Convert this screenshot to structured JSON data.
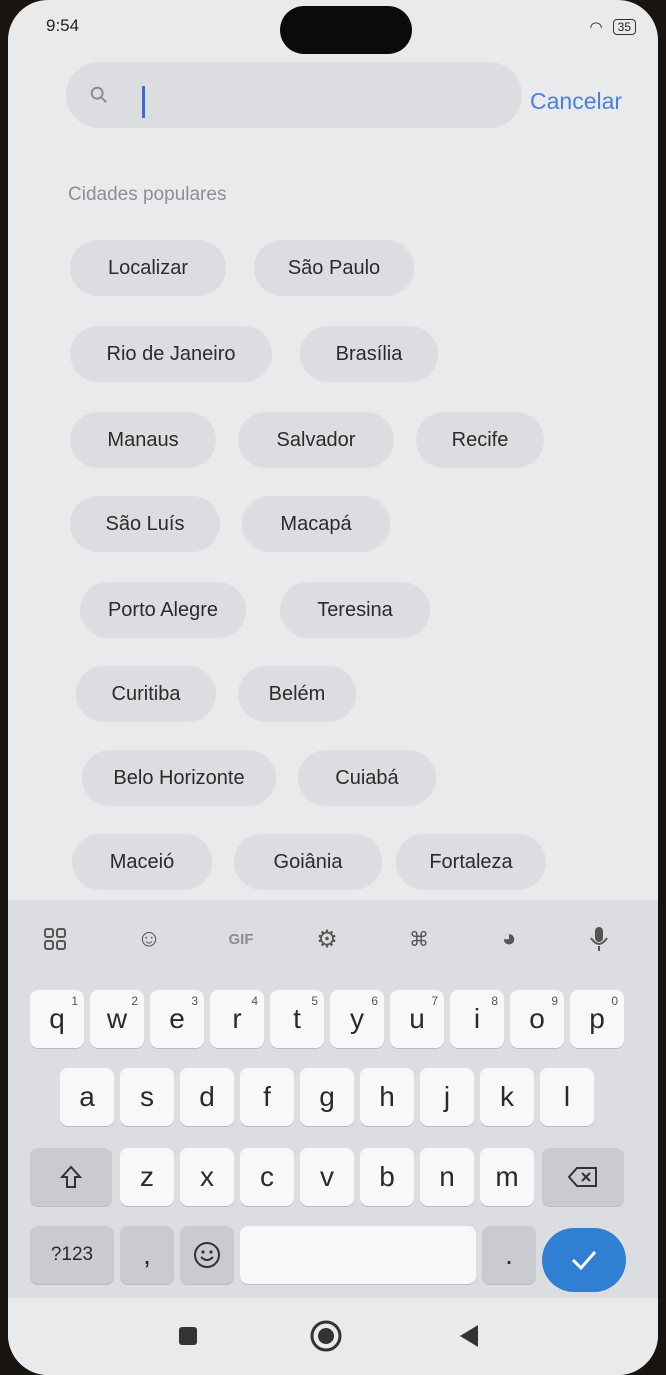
{
  "status": {
    "time": "9:54",
    "battery": "35",
    "dots": "···"
  },
  "search": {
    "value": "",
    "placeholder": "",
    "cancel_label": "Cancelar"
  },
  "section_title": "Cidades populares",
  "cities": [
    "Localizar",
    "São Paulo",
    "Rio de Janeiro",
    "Brasília",
    "Manaus",
    "Salvador",
    "Recife",
    "São Luís",
    "Macapá",
    "Porto Alegre",
    "Teresina",
    "Curitiba",
    "Belém",
    "Belo Horizonte",
    "Cuiabá",
    "Maceió",
    "Goiânia",
    "Fortaleza"
  ],
  "toolbar": {
    "gif_label": "GIF"
  },
  "keyboard": {
    "row1": [
      "q",
      "w",
      "e",
      "r",
      "t",
      "y",
      "u",
      "i",
      "o",
      "p"
    ],
    "row1_nums": [
      "1",
      "2",
      "3",
      "4",
      "5",
      "6",
      "7",
      "8",
      "9",
      "0"
    ],
    "row2": [
      "a",
      "s",
      "d",
      "f",
      "g",
      "h",
      "j",
      "k",
      "l"
    ],
    "row3": [
      "z",
      "x",
      "c",
      "v",
      "b",
      "n",
      "m"
    ],
    "numbers_label": "?123",
    "comma": ",",
    "period": "."
  },
  "colors": {
    "accent": "#2f7fd3",
    "link": "#4b7fd8"
  }
}
